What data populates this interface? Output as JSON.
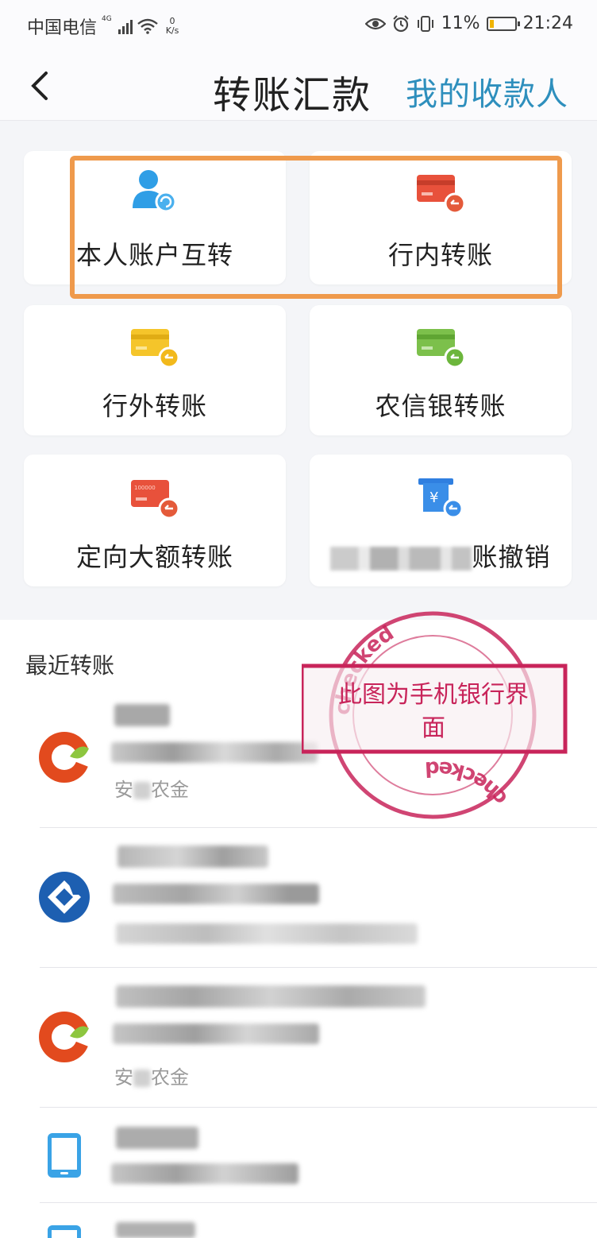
{
  "status_bar": {
    "carrier": "中国电信",
    "network": "4G",
    "speed_value": "0",
    "speed_unit": "K/s",
    "battery_percent": "11%",
    "time": "21:24"
  },
  "header": {
    "title": "转账汇款",
    "payees_link": "我的收款人"
  },
  "grid": {
    "own_accounts": "本人账户互转",
    "intra_bank": "行内转账",
    "inter_bank": "行外转账",
    "rural_credit": "农信银转账",
    "directed_large": "定向大额转账",
    "cancel_suffix": "账撤销"
  },
  "recent": {
    "title": "最近转账",
    "items": [
      {
        "bank_prefix": "安",
        "bank_suffix": "农金"
      },
      {
        "bank_prefix": "",
        "bank_suffix": ""
      },
      {
        "bank_prefix": "安",
        "bank_suffix": "农金"
      },
      {
        "bank_prefix": "",
        "bank_suffix": ""
      }
    ]
  },
  "stamp": {
    "word": "checked",
    "line1": "此图为手机银行界",
    "line2": "面"
  },
  "colors": {
    "accent_blue": "#2e8fbd",
    "highlight_orange": "#ef9a4c",
    "stamp_red": "#c8245a"
  }
}
